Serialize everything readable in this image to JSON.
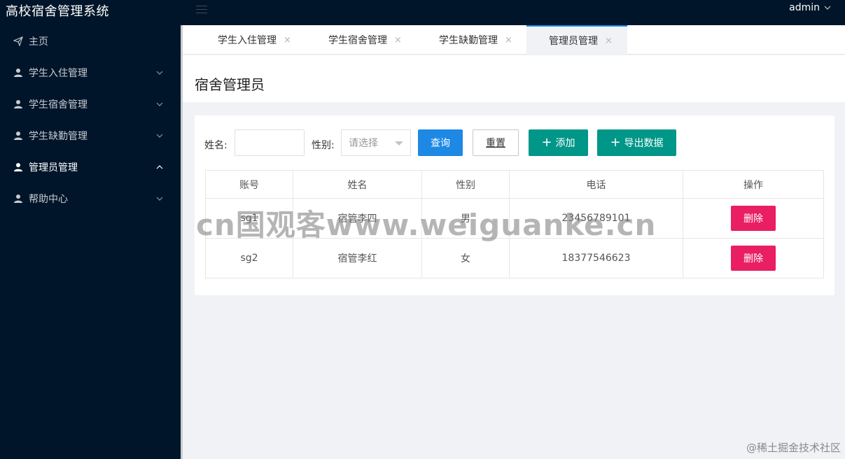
{
  "app": {
    "title": "高校宿舍管理系统",
    "user": "admin"
  },
  "sidebar": {
    "items": [
      {
        "label": "主页",
        "icon": "paper-plane-icon"
      },
      {
        "label": "学生入住管理",
        "icon": "user-icon"
      },
      {
        "label": "学生宿舍管理",
        "icon": "user-icon"
      },
      {
        "label": "学生缺勤管理",
        "icon": "user-icon"
      },
      {
        "label": "管理员管理",
        "icon": "user-icon",
        "active": true
      },
      {
        "label": "帮助中心",
        "icon": "user-icon"
      }
    ]
  },
  "tabs": [
    {
      "label": "学生入住管理"
    },
    {
      "label": "学生宿舍管理"
    },
    {
      "label": "学生缺勤管理"
    },
    {
      "label": "管理员管理",
      "active": true
    }
  ],
  "tab_close": "×",
  "page": {
    "title": "宿舍管理员"
  },
  "search": {
    "name_label": "姓名:",
    "name_value": "",
    "gender_label": "性别:",
    "gender_placeholder": "请选择",
    "query_button": "查询",
    "reset_button": "重置",
    "add_button": "添加",
    "export_button": "导出数据"
  },
  "table": {
    "headers": [
      "账号",
      "姓名",
      "性别",
      "电话",
      "操作"
    ],
    "rows": [
      {
        "account": "sg1",
        "name": "宿管李四",
        "gender": "男",
        "phone": "23456789101",
        "action": "删除"
      },
      {
        "account": "sg2",
        "name": "宿管李红",
        "gender": "女",
        "phone": "18377546623",
        "action": "删除"
      }
    ]
  },
  "watermarks": {
    "center": "cn国观客www.weiguanke.cn",
    "corner": "@稀土掘金技术社区"
  },
  "colors": {
    "sidebar_bg": "#001529",
    "primary_blue": "#1e88e5",
    "green": "#009688",
    "danger_pink": "#e91e63"
  }
}
